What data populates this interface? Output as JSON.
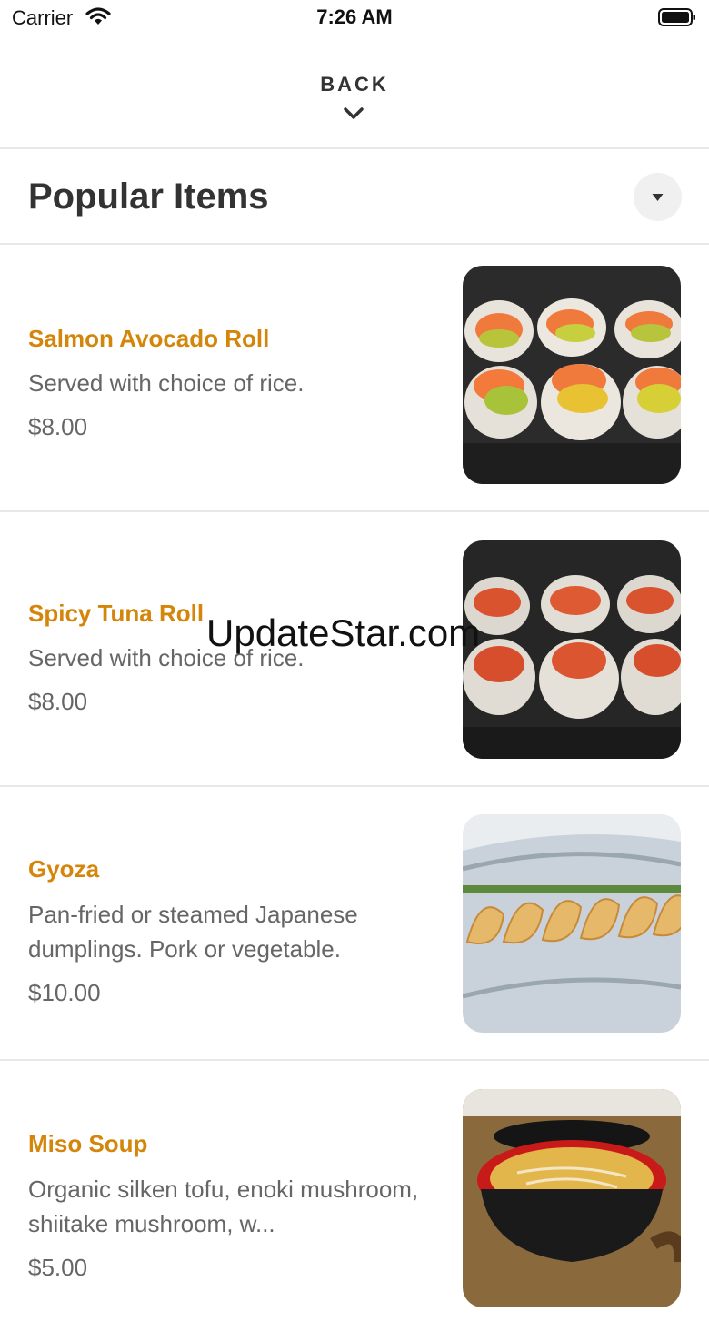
{
  "status_bar": {
    "carrier": "Carrier",
    "time": "7:26 AM"
  },
  "header": {
    "back_label": "BACK"
  },
  "section": {
    "title": "Popular Items"
  },
  "items": [
    {
      "name": "Salmon Avocado Roll",
      "description": "Served with choice of rice.",
      "price": "$8.00",
      "photo": "salmon-avocado-roll-photo"
    },
    {
      "name": "Spicy Tuna Roll",
      "description": "Served with choice of rice.",
      "price": "$8.00",
      "photo": "spicy-tuna-roll-photo"
    },
    {
      "name": "Gyoza",
      "description": "Pan-fried or steamed Japanese dumplings. Pork or vegetable.",
      "price": "$10.00",
      "photo": "gyoza-photo"
    },
    {
      "name": "Miso Soup",
      "description": "Organic silken tofu, enoki mushroom, shiitake mushroom, w...",
      "price": "$5.00",
      "photo": "miso-soup-photo"
    }
  ],
  "watermark": "UpdateStar.com",
  "colors": {
    "accent": "#d4860b",
    "text": "#333333",
    "muted": "#666666"
  }
}
